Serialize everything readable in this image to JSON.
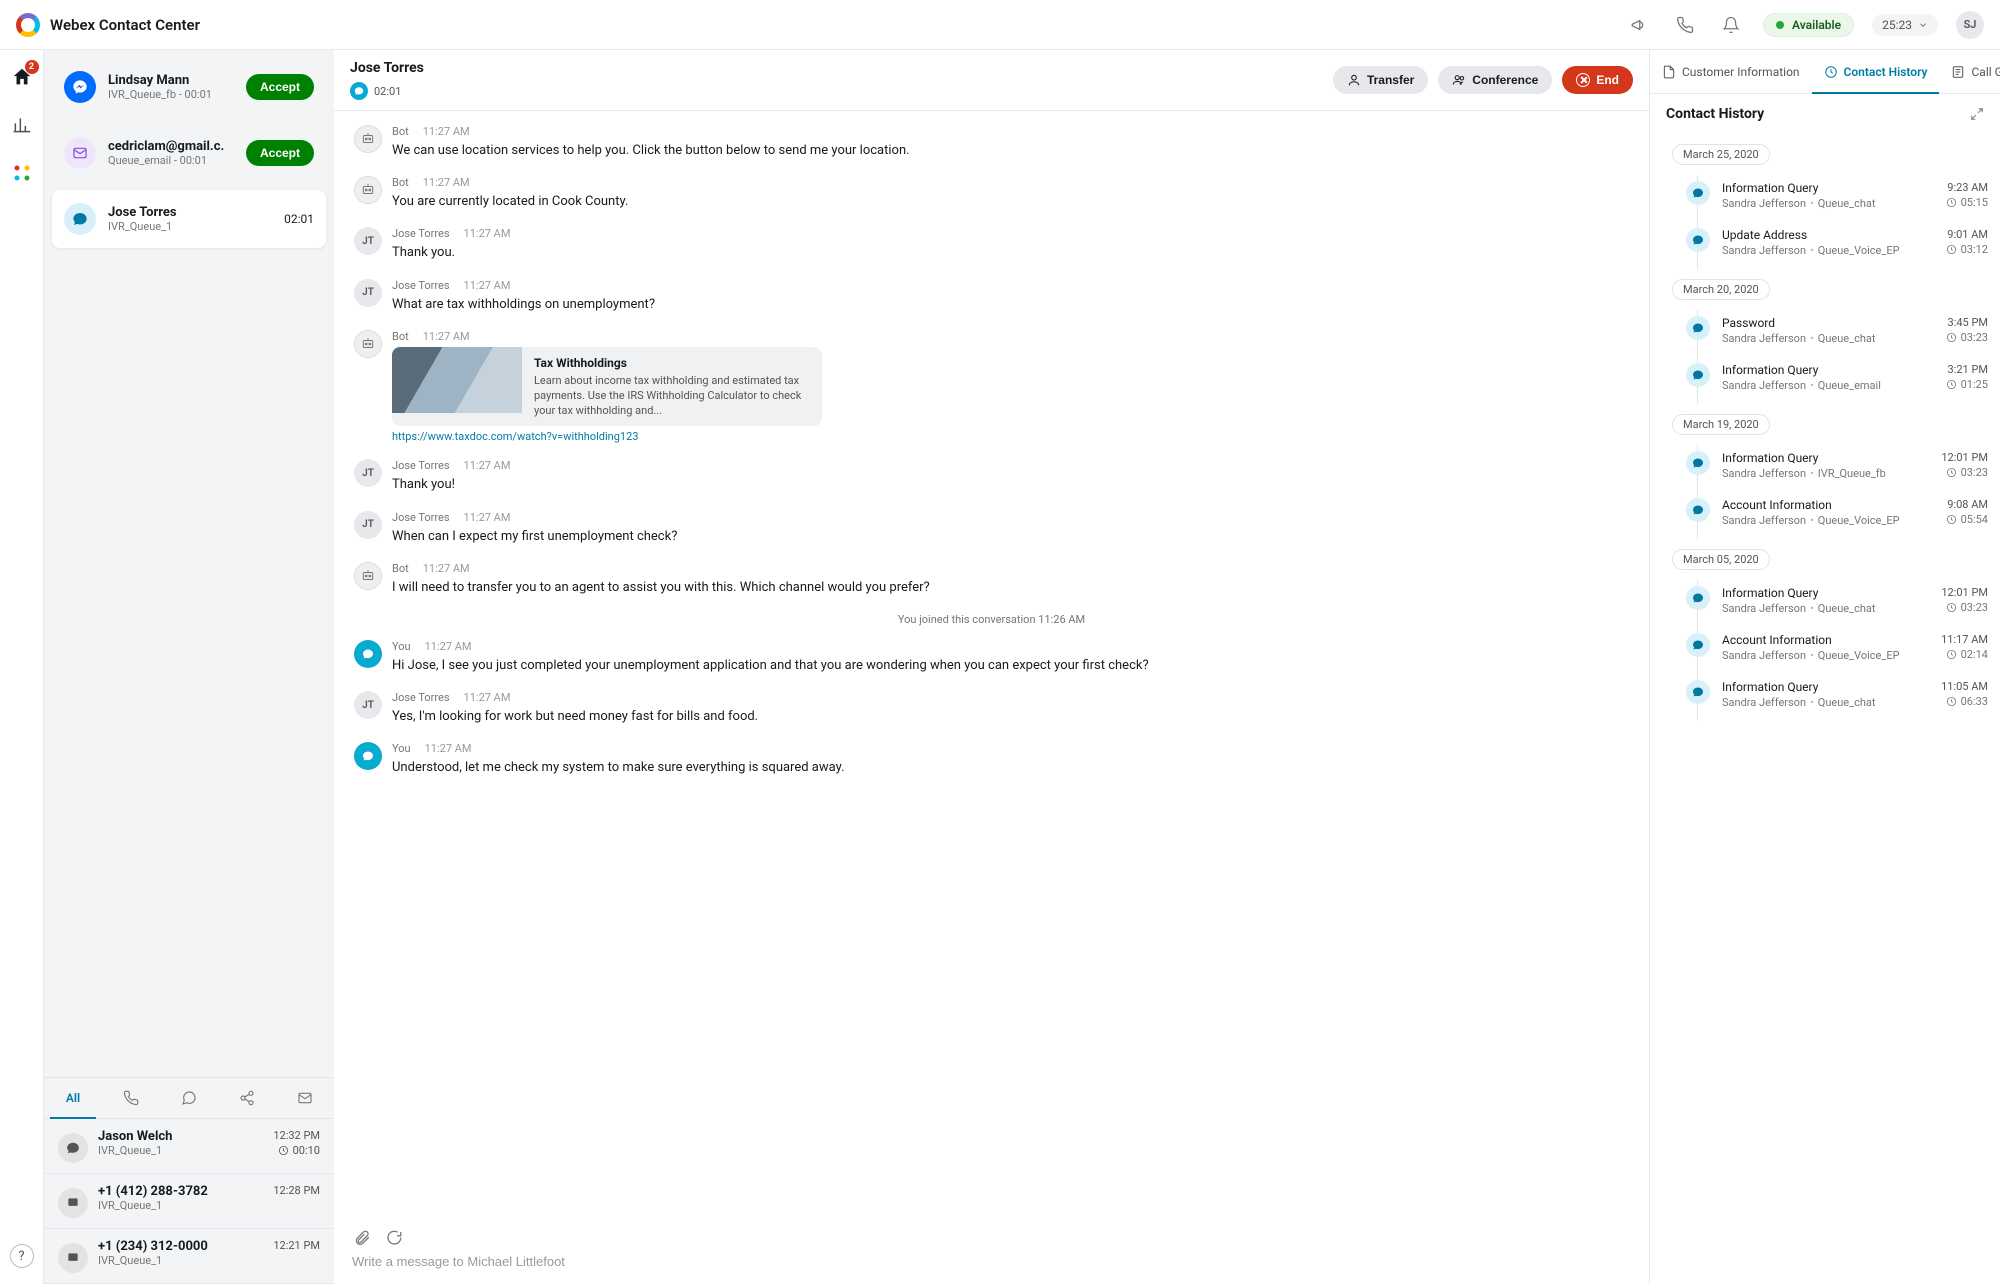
{
  "header": {
    "app_title": "Webex Contact Center",
    "status_label": "Available",
    "session_timer": "25:23",
    "agent_initials": "SJ",
    "home_badge": "2"
  },
  "tasks": {
    "incoming": [
      {
        "name": "Lindsay Mann",
        "meta": "IVR_Queue_fb - 00:01",
        "accept": "Accept",
        "icon": "messenger"
      },
      {
        "name": "cedriclam@gmail.c.",
        "meta": "Queue_email - 00:01",
        "accept": "Accept",
        "icon": "email"
      }
    ],
    "active": {
      "name": "Jose Torres",
      "meta": "IVR_Queue_1",
      "timer": "02:01",
      "icon": "chat"
    }
  },
  "filters": {
    "all_label": "All"
  },
  "recent": [
    {
      "name": "Jason Welch",
      "meta": "IVR_Queue_1",
      "time": "12:32 PM",
      "duration": "00:10",
      "icon": "chat"
    },
    {
      "name": "+1 (412) 288-3782",
      "meta": "IVR_Queue_1",
      "time": "12:28 PM",
      "duration": "",
      "icon": "sms"
    },
    {
      "name": "+1 (234) 312-0000",
      "meta": "IVR_Queue_1",
      "time": "12:21 PM",
      "duration": "",
      "icon": "sms"
    }
  ],
  "conversation": {
    "customer_name": "Jose Torres",
    "channel_timer": "02:01",
    "actions": {
      "transfer": "Transfer",
      "conference": "Conference",
      "end": "End"
    },
    "system_join": "You joined this conversation",
    "system_join_time": "11:26 AM",
    "messages": [
      {
        "author": "Bot",
        "avatar": "bot",
        "time": "11:27 AM",
        "text": "We can use location services to help you.  Click the button below to send me your location."
      },
      {
        "author": "Bot",
        "avatar": "bot",
        "time": "11:27 AM",
        "text": "You are currently located in Cook County."
      },
      {
        "author": "Jose Torres",
        "avatar": "JT",
        "time": "11:27 AM",
        "text": "Thank you."
      },
      {
        "author": "Jose Torres",
        "avatar": "JT",
        "time": "11:27 AM",
        "text": "What are tax withholdings on unemployment?"
      },
      {
        "author": "Bot",
        "avatar": "bot",
        "time": "11:27 AM",
        "card": {
          "title": "Tax Withholdings",
          "body": "Learn about income tax withholding and estimated tax payments. Use the IRS Withholding Calculator to check your tax withholding and...",
          "link": "https://www.taxdoc.com/watch?v=withholding123"
        }
      },
      {
        "author": "Jose Torres",
        "avatar": "JT",
        "time": "11:27 AM",
        "text": "Thank you!"
      },
      {
        "author": "Jose Torres",
        "avatar": "JT",
        "time": "11:27 AM",
        "text": "When can I expect my first unemployment check?"
      },
      {
        "author": "Bot",
        "avatar": "bot",
        "time": "11:27 AM",
        "text": "I will need to transfer you to an agent to assist you with this.  Which channel would you prefer?"
      },
      {
        "system": true
      },
      {
        "author": "You",
        "avatar": "you",
        "time": "11:27 AM",
        "text": "Hi Jose, I see you just completed your unemployment application and that you are wondering when you can expect your first check?"
      },
      {
        "author": "Jose Torres",
        "avatar": "JT",
        "time": "11:27 AM",
        "text": "Yes, I'm looking for work but need money fast for bills and food."
      },
      {
        "author": "You",
        "avatar": "you",
        "time": "11:27 AM",
        "text": "Understood, let me check my system to make sure everything is squared away."
      }
    ],
    "composer_placeholder": "Write a message to Michael Littlefoot"
  },
  "right": {
    "tabs": {
      "customer_info": "Customer Information",
      "contact_history": "Contact History",
      "call_guide": "Call Guide"
    },
    "panel_title": "Contact History",
    "groups": [
      {
        "date": "March 25, 2020",
        "items": [
          {
            "title": "Information Query",
            "agent": "Sandra Jefferson",
            "queue": "Queue_chat",
            "time": "9:23 AM",
            "dur": "05:15"
          },
          {
            "title": "Update Address",
            "agent": "Sandra Jefferson",
            "queue": "Queue_Voice_EP",
            "time": "9:01 AM",
            "dur": "03:12"
          }
        ]
      },
      {
        "date": "March 20, 2020",
        "items": [
          {
            "title": "Password",
            "agent": "Sandra Jefferson",
            "queue": "Queue_chat",
            "time": "3:45 PM",
            "dur": "03:23"
          },
          {
            "title": "Information Query",
            "agent": "Sandra Jefferson",
            "queue": "Queue_email",
            "time": "3:21 PM",
            "dur": "01:25"
          }
        ]
      },
      {
        "date": "March 19, 2020",
        "items": [
          {
            "title": "Information Query",
            "agent": "Sandra Jefferson",
            "queue": "IVR_Queue_fb",
            "time": "12:01 PM",
            "dur": "03:23"
          },
          {
            "title": "Account Information",
            "agent": "Sandra Jefferson",
            "queue": "Queue_Voice_EP",
            "time": "9:08 AM",
            "dur": "05:54"
          }
        ]
      },
      {
        "date": "March 05, 2020",
        "items": [
          {
            "title": "Information Query",
            "agent": "Sandra Jefferson",
            "queue": "Queue_chat",
            "time": "12:01 PM",
            "dur": "03:23"
          },
          {
            "title": "Account Information",
            "agent": "Sandra Jefferson",
            "queue": "Queue_Voice_EP",
            "time": "11:17 AM",
            "dur": "02:14"
          },
          {
            "title": "Information Query",
            "agent": "Sandra Jefferson",
            "queue": "Queue_chat",
            "time": "11:05 AM",
            "dur": "06:33"
          }
        ]
      }
    ]
  }
}
